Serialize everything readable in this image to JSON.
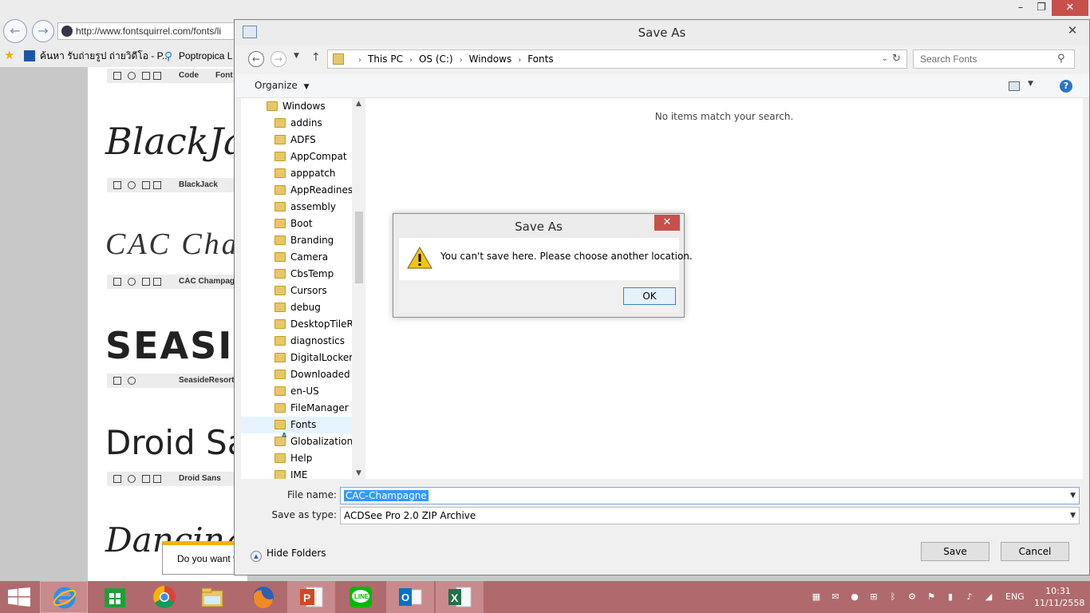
{
  "browser": {
    "url": "http://www.fontsquirrel.com/fonts/li",
    "favorites": [
      "ค้นหา รับถ่ายรูป ถ่ายวิดีโอ - P...",
      "Poptropica L"
    ],
    "tool_rows": [
      "Code",
      "BlackJack",
      "CAC Champag",
      "SeasideResort",
      "Droid Sans"
    ],
    "tool_row_first_extra": "Font",
    "previews": [
      "BlackJack",
      "CAC Champ",
      "SEASIDE",
      "Droid Sa",
      "Dancing S"
    ],
    "download_prompt": "Do you want t"
  },
  "save_dialog": {
    "title": "Save As",
    "breadcrumb": [
      "This PC",
      "OS (C:)",
      "Windows",
      "Fonts"
    ],
    "search_placeholder": "Search Fonts",
    "organize_label": "Organize",
    "tree_items": [
      "Windows",
      "addins",
      "ADFS",
      "AppCompat",
      "apppatch",
      "AppReadines",
      "assembly",
      "Boot",
      "Branding",
      "Camera",
      "CbsTemp",
      "Cursors",
      "debug",
      "DesktopTileR",
      "diagnostics",
      "DigitalLocker",
      "Downloaded",
      "en-US",
      "FileManager",
      "Fonts",
      "Globalization",
      "Help",
      "IME"
    ],
    "selected_item": "Fonts",
    "empty_message": "No items match your search.",
    "file_name_label": "File name:",
    "file_name_value": "CAC-Champagne",
    "save_type_label": "Save as type:",
    "save_type_value": "ACDSee Pro 2.0 ZIP Archive",
    "hide_folders_label": "Hide Folders",
    "save_label": "Save",
    "cancel_label": "Cancel"
  },
  "error_dialog": {
    "title": "Save As",
    "message": "You can't save here. Please choose another location.",
    "ok_label": "OK"
  },
  "taskbar": {
    "apps": [
      "start",
      "internet-explorer",
      "store",
      "chrome",
      "file-explorer",
      "firefox",
      "powerpoint",
      "line",
      "outlook",
      "excel"
    ],
    "language": "ENG",
    "time": "10:31",
    "date": "11/11/2558"
  },
  "colors": {
    "taskbar": "#b06a6e",
    "close_button": "#c7504b",
    "selection": "#3399ff",
    "warning": "#f0c419"
  }
}
